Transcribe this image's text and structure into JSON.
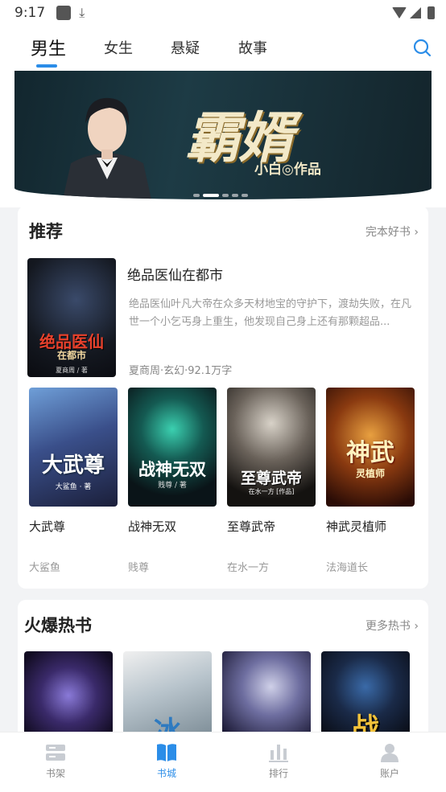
{
  "status": {
    "time": "9:17"
  },
  "tabs": [
    {
      "label": "男生",
      "active": true
    },
    {
      "label": "女生",
      "active": false
    },
    {
      "label": "悬疑",
      "active": false
    },
    {
      "label": "故事",
      "active": false
    }
  ],
  "banner": {
    "title": "霸婿",
    "subtitle": "小白◎作品",
    "slides": 5,
    "active_slide": 2
  },
  "recommend": {
    "title": "推荐",
    "more": "完本好书",
    "featured": {
      "title": "绝品医仙在都市",
      "desc": "绝品医仙叶凡大帝在众多天材地宝的守护下，渡劫失败，在凡世一个小乞丐身上重生，他发现自己身上还有那颗超品...",
      "meta": "夏商周·玄幻·92.1万字",
      "cover_text": "绝品医仙",
      "cover_sub": "在都市",
      "cover_author": "夏商周 / 著"
    },
    "books": [
      {
        "title": "大武尊",
        "author": "大鲨鱼",
        "cover_text": "大武尊",
        "cover_sub": "大鲨鱼 · 著"
      },
      {
        "title": "战神无双",
        "author": "贱尊",
        "cover_text": "战神无双",
        "cover_sub": "贱尊 / 著"
      },
      {
        "title": "至尊武帝",
        "author": "在水一方",
        "cover_text": "至尊武帝",
        "cover_sub": "在水一方 [作品]"
      },
      {
        "title": "神武灵植师",
        "author": "法海道长",
        "cover_text": "神武",
        "cover_sub": "灵植师"
      }
    ]
  },
  "hot": {
    "title": "火爆热书",
    "more": "更多热书",
    "covers": [
      {
        "text": ""
      },
      {
        "text": "冰"
      },
      {
        "text": ""
      },
      {
        "text": "战"
      }
    ]
  },
  "bottom_nav": [
    {
      "label": "书架",
      "icon": "bookshelf-icon",
      "active": false
    },
    {
      "label": "书城",
      "icon": "book-open-icon",
      "active": true
    },
    {
      "label": "排行",
      "icon": "bar-chart-icon",
      "active": false
    },
    {
      "label": "账户",
      "icon": "user-icon",
      "active": false
    }
  ],
  "colors": {
    "accent": "#2b8de8"
  }
}
